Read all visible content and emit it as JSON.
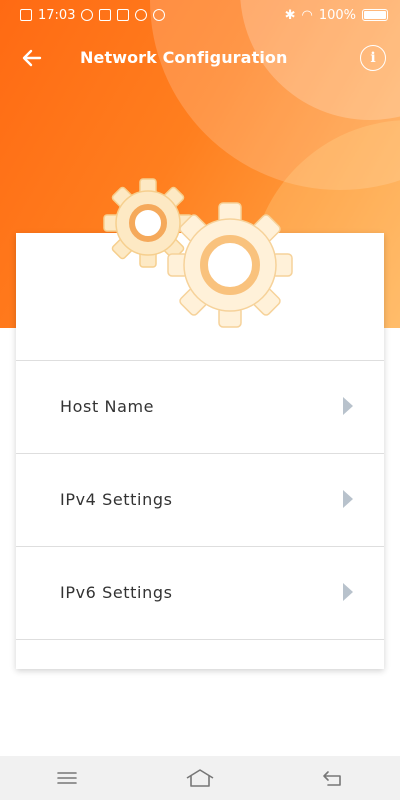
{
  "status_bar": {
    "time": "17:03",
    "battery": "100%"
  },
  "app_bar": {
    "title": "Network Configuration",
    "info_label": "i"
  },
  "menu": {
    "items": [
      {
        "label": "Host Name"
      },
      {
        "label": "IPv4 Settings"
      },
      {
        "label": "IPv6 Settings"
      }
    ]
  },
  "colors": {
    "accent_orange": "#ff7a1a",
    "chevron_gray": "#b8c2cc"
  },
  "icons": {
    "back": "arrow-left-icon",
    "info": "info-icon",
    "chevron": "chevron-right-icon",
    "gears": "gears-icon",
    "nav_menu": "menu-icon",
    "nav_home": "home-icon",
    "nav_back": "back-icon"
  }
}
